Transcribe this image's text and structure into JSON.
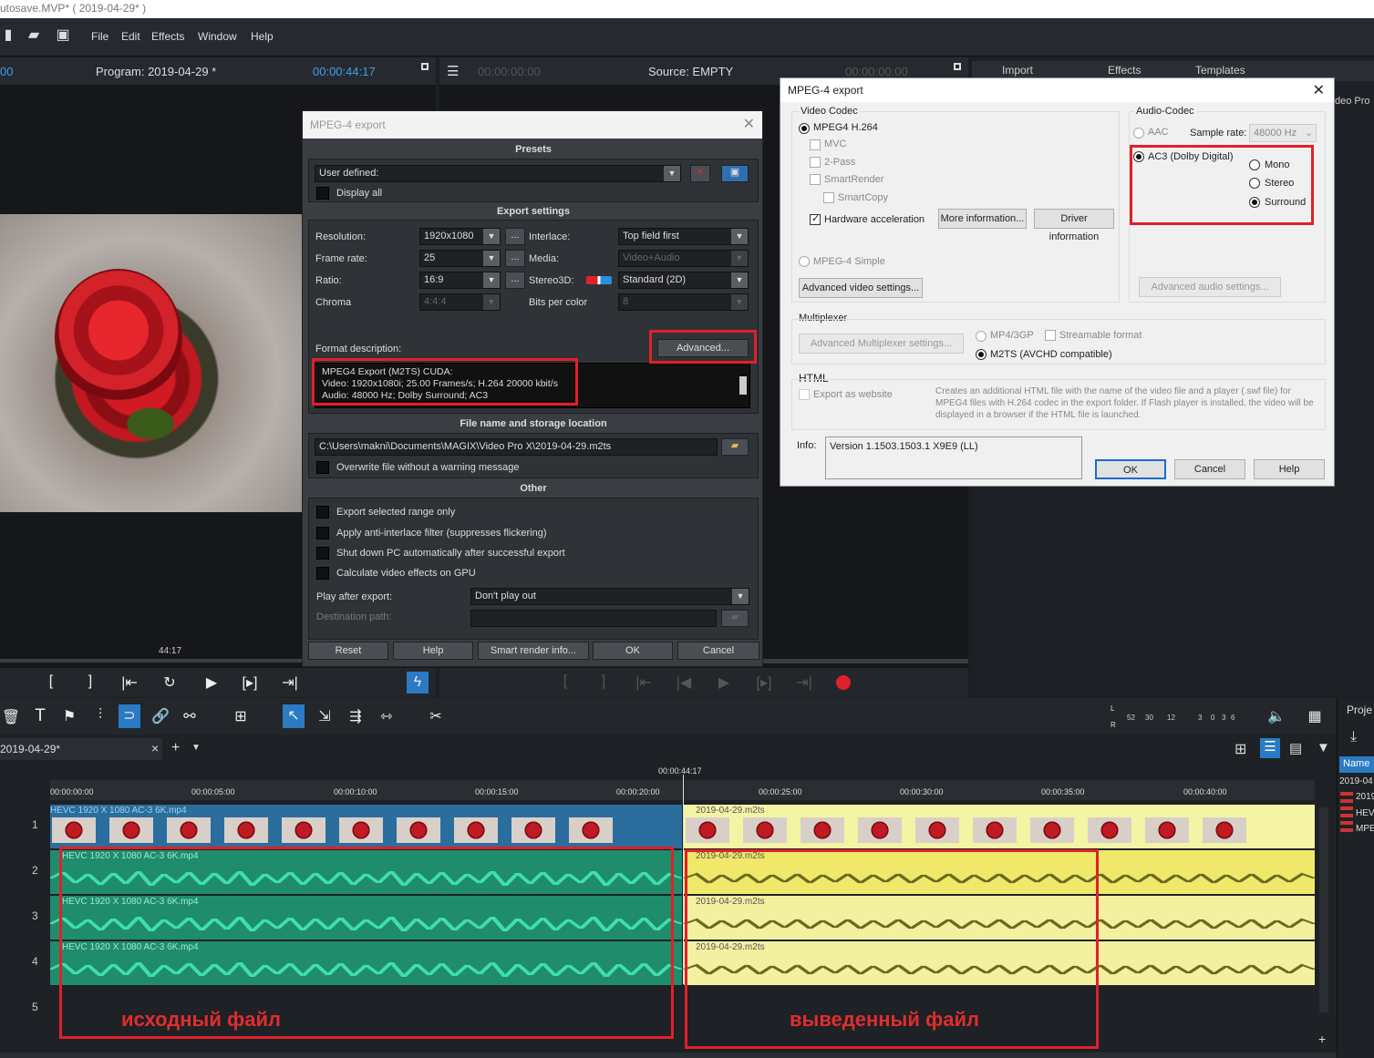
{
  "app": {
    "title": "utosave.MVP* ( 2019-04-29* )",
    "menu": [
      "File",
      "Edit",
      "Effects",
      "Window",
      "Help"
    ]
  },
  "program_monitor": {
    "left_timecode": "00",
    "title": "Program: 2019-04-29 *",
    "timecode": "00:00:44:17",
    "scrub_time": "44:17"
  },
  "source_monitor": {
    "timecode": "00:00:00:00",
    "title": "Source: EMPTY",
    "timecode2": "00:00:00:00"
  },
  "right_tabs": [
    "Import",
    "Effects",
    "Templates"
  ],
  "right_panel_partial": "deo Pro",
  "dialog_dark": {
    "title": "MPEG-4 export",
    "presets_header": "Presets",
    "preset_value": "User defined:",
    "display_all": "Display all",
    "export_settings_header": "Export settings",
    "resolution_label": "Resolution:",
    "resolution_value": "1920x1080",
    "framerate_label": "Frame rate:",
    "framerate_value": "25",
    "ratio_label": "Ratio:",
    "ratio_value": "16:9",
    "chroma_label": "Chroma",
    "chroma_value": "4:4:4",
    "interlace_label": "Interlace:",
    "interlace_value": "Top field first",
    "media_label": "Media:",
    "media_value": "Video+Audio",
    "stereo_label": "Stereo3D:",
    "stereo_value": "Standard (2D)",
    "bits_label": "Bits per color",
    "bits_value": "8",
    "ellipsis": "...",
    "format_desc_label": "Format description:",
    "advanced_button": "Advanced...",
    "format_lines": [
      "MPEG4 Export (M2TS) CUDA:",
      "Video: 1920x1080i; 25.00 Frames/s; H.264 20000 kbit/s",
      "Audio: 48000 Hz; Dolby Surround;  AC3"
    ],
    "file_header": "File name and storage location",
    "file_path": "C:\\Users\\makni\\Documents\\MAGIX\\Video Pro X\\2019-04-29.m2ts",
    "overwrite": "Overwrite file without a warning message",
    "other_header": "Other",
    "other_checks": [
      "Export selected range only",
      "Apply anti-interlace filter (suppresses flickering)",
      "Shut down PC automatically after successful export",
      "Calculate video effects on GPU"
    ],
    "play_after_label": "Play after export:",
    "play_after_value": "Don't play out",
    "destination_label": "Destination path:",
    "buttons": [
      "Reset",
      "Help",
      "Smart render info...",
      "OK",
      "Cancel"
    ]
  },
  "dialog_light": {
    "title": "MPEG-4 export",
    "video_codec_group": "Video Codec",
    "mpeg4_h264": "MPEG4 H.264",
    "mvc": "MVC",
    "two_pass": "2-Pass",
    "smartrender": "SmartRender",
    "smartcopy": "SmartCopy",
    "hw_accel": "Hardware acceleration",
    "more_info": "More information...",
    "driver_info": "Driver information",
    "mpeg4_simple": "MPEG-4 Simple",
    "adv_video": "Advanced video settings...",
    "audio_codec_group": "Audio-Codec",
    "aac": "AAC",
    "sample_rate_label": "Sample rate:",
    "sample_rate_value": "48000 Hz",
    "ac3": "AC3 (Dolby Digital)",
    "mono": "Mono",
    "stereo": "Stereo",
    "surround": "Surround",
    "adv_audio": "Advanced audio settings...",
    "multiplexer_group": "Multiplexer",
    "adv_mux": "Advanced Multiplexer settings...",
    "mp4_3gp": "MP4/3GP",
    "streamable": "Streamable format",
    "m2ts": "M2TS (AVCHD compatible)",
    "html_group": "HTML",
    "export_website": "Export as website",
    "html_desc": "Creates an additional HTML file with the name of the video file and a player (.swf file) for MPEG4 files with H.264 codec in the export folder. If Flash player is installed, the video will be displayed in a browser if the HTML file is launched.",
    "info_label": "Info:",
    "info_value": "Version 1.1503.1503.1 X9E9 (LL)",
    "ok": "OK",
    "cancel": "Cancel",
    "help": "Help"
  },
  "timeline": {
    "project_tab": "2019-04-29*",
    "close": "×",
    "add": "+",
    "current_time": "00:00:44:17",
    "ruler": [
      "00:00:00:00",
      "00:00:05:00",
      "00:00:10:00",
      "00:00:15:00",
      "00:00:20:00",
      "00:00:25:00",
      "00:00:30:00",
      "00:00:35:00",
      "00:00:40:00"
    ],
    "meter_labels": [
      "L",
      "R",
      "52",
      "30",
      "12",
      "3",
      "0",
      "3",
      "6"
    ],
    "track_numbers": [
      "1",
      "2",
      "3",
      "4",
      "5"
    ],
    "source_clip": "HEVC 1920 X 1080 AC-3 6K.mp4",
    "output_clip": "2019-04-29.m2ts",
    "source_caption": "исходный файл",
    "output_caption": "выведенный файл"
  },
  "project_panel": {
    "title": "Proje",
    "name_col": "Name",
    "items": [
      "2019-04",
      "2019",
      "HEV",
      "MPE"
    ]
  },
  "colors": {
    "highlight_red": "#e0202a",
    "accent_blue": "#3ea0ea",
    "video_clip": "#2b6e9e",
    "audio_clip": "#1f8c6c",
    "output_clip": "#f5f3a4"
  }
}
